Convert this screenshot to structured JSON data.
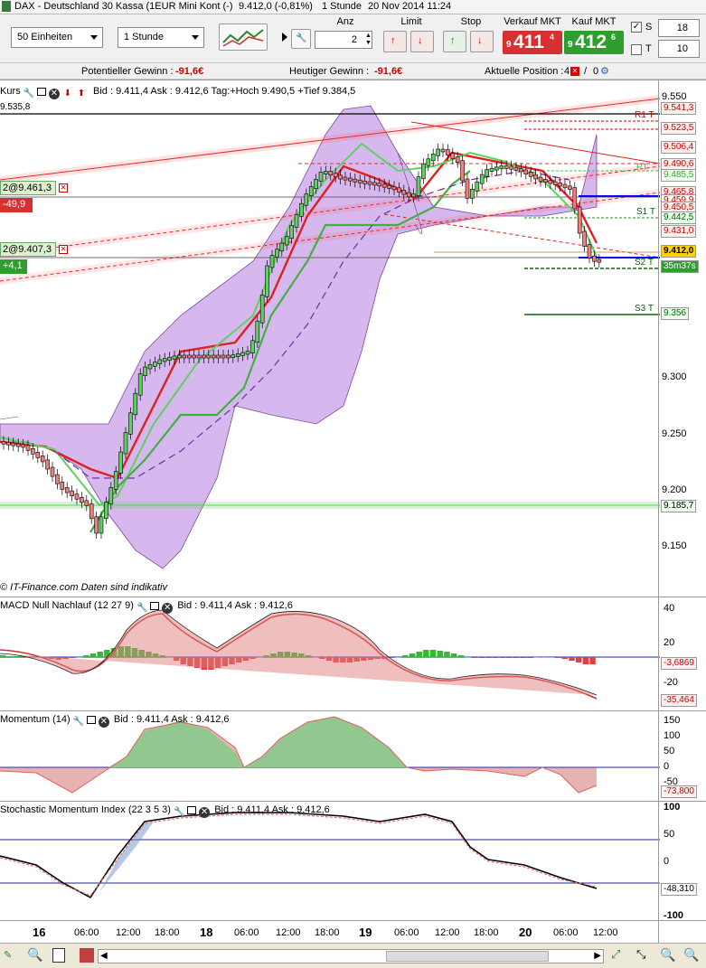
{
  "title": {
    "instrument": "DAX - Deutschland 30 Kassa (1EUR Mini Kont (-)",
    "price": "9.412,0 (-0,81%)",
    "timeframe": "1 Stunde",
    "date": "20 Nov 2014 11:24"
  },
  "toolbar": {
    "units": "50 Einheiten",
    "interval": "1 Stunde",
    "anz_label": "Anz",
    "anz_value": "2",
    "limit_label": "Limit",
    "stop_label": "Stop",
    "sell_label": "Verkauf MKT",
    "buy_label": "Kauf MKT",
    "sell_prefix": "9",
    "sell_main": "411",
    "sell_decimal": "4",
    "buy_prefix": "9",
    "buy_main": "412",
    "buy_decimal": "6",
    "s_label": "S",
    "s_value": "18",
    "t_label": "T",
    "t_value": "10"
  },
  "info": {
    "potential_label": "Potentieller Gewinn :",
    "potential_value": "-91,6€",
    "today_label": "Heutiger Gewinn :",
    "today_value": "-91,6€",
    "position_label": "Aktuelle Position :",
    "position_a": "4",
    "position_b": "0"
  },
  "main_panel": {
    "name": "Kurs",
    "quote": "Bid : 9.411,4 Ask : 9.412,6 Tag:+Hoch 9.490,5 +Tief 9.384,5",
    "top_level": "9.535,8",
    "footer": "© IT-Finance.com  Daten sind indikativ",
    "order1_label": "2@9.461,3",
    "order1_pl": "-49,9",
    "order2_label": "2@9.407,3",
    "order2_pl": "+4,1",
    "axis_ticks": [
      "9.550",
      "9.300",
      "9.250",
      "9.200",
      "9.150"
    ],
    "pivots": [
      "R1 T",
      "PT",
      "S1 T",
      "S2 T",
      "S3 T"
    ],
    "price_tags": [
      "9.541,3",
      "9.523,5",
      "9.506,4",
      "9.490,6",
      "9.485,5",
      "9.465,8",
      "9.459,9",
      "9.450,5",
      "9.442,5",
      "9.431,0",
      "9.412,0",
      "35m37s",
      "9.356",
      "9.185,7"
    ]
  },
  "macd_panel": {
    "name": "MACD Null Nachlauf (12 27 9)",
    "quote": "Bid : 9.411,4 Ask : 9.412,6",
    "axis_ticks": [
      "40",
      "20",
      "-20"
    ],
    "value_tags": [
      "-3,6869",
      "-35,464"
    ]
  },
  "momentum_panel": {
    "name": "Momentum (14)",
    "quote": "Bid : 9.411,4 Ask : 9.412,6",
    "axis_ticks": [
      "150",
      "100",
      "50",
      "0",
      "-50"
    ],
    "value_tags": [
      "-73,800"
    ]
  },
  "stoch_panel": {
    "name": "Stochastic Momentum Index (22 3 5 3)",
    "quote": "Bid : 9.411,4 Ask : 9.412,6",
    "axis_ticks": [
      "100",
      "50",
      "0",
      "-100"
    ],
    "value_tags": [
      "-48,310"
    ]
  },
  "time_axis": [
    "16",
    "06:00",
    "12:00",
    "18:00",
    "18",
    "06:00",
    "12:00",
    "18:00",
    "19",
    "06:00",
    "12:00",
    "18:00",
    "20",
    "06:00",
    "12:00"
  ],
  "colors": {
    "sell": "#d83030",
    "buy": "#2e9e2e",
    "cloud": "#c8a0e8"
  }
}
